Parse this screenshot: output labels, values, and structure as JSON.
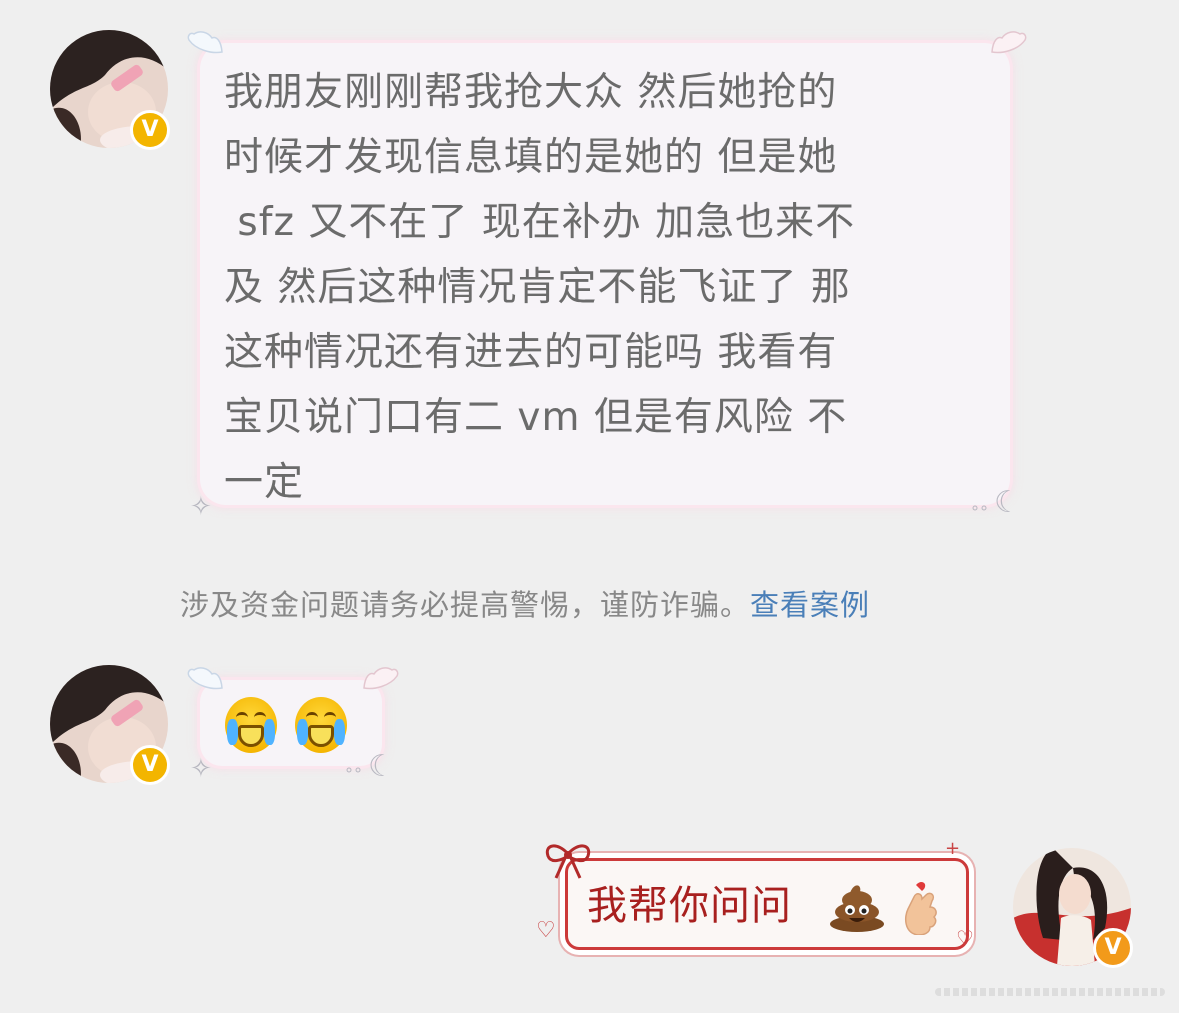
{
  "messages": [
    {
      "sender": "friend",
      "badge": "V",
      "text": "我朋友刚刚帮我抢大众 然后她抢的\n时候才发现信息填的是她的 但是她\n sfz 又不在了 现在补办 加急也来不\n及 然后这种情况肯定不能飞证了 那\n这种情况还有进去的可能吗 我看有\n宝贝说门口有二 vm 但是有风险 不\n一定"
    },
    {
      "sender": "friend",
      "badge": "V",
      "emojis": [
        "loudly-crying-face-emoji",
        "loudly-crying-face-emoji"
      ]
    },
    {
      "sender": "me",
      "badge": "V",
      "text": "我帮你问问",
      "emojis": [
        "poop-emoji",
        "finger-heart-emoji"
      ]
    }
  ],
  "notice": {
    "text": "涉及资金问题请务必提高警惕，谨防诈骗。",
    "link": "查看案例"
  },
  "colors": {
    "background": "#efefef",
    "left_bubble": "#f7f4f8",
    "right_bubble_border": "#cc3a3a",
    "right_text": "#a8201f",
    "link": "#4a7fb8",
    "badge_yellow": "#f3b500",
    "badge_orange": "#f29a1a"
  }
}
